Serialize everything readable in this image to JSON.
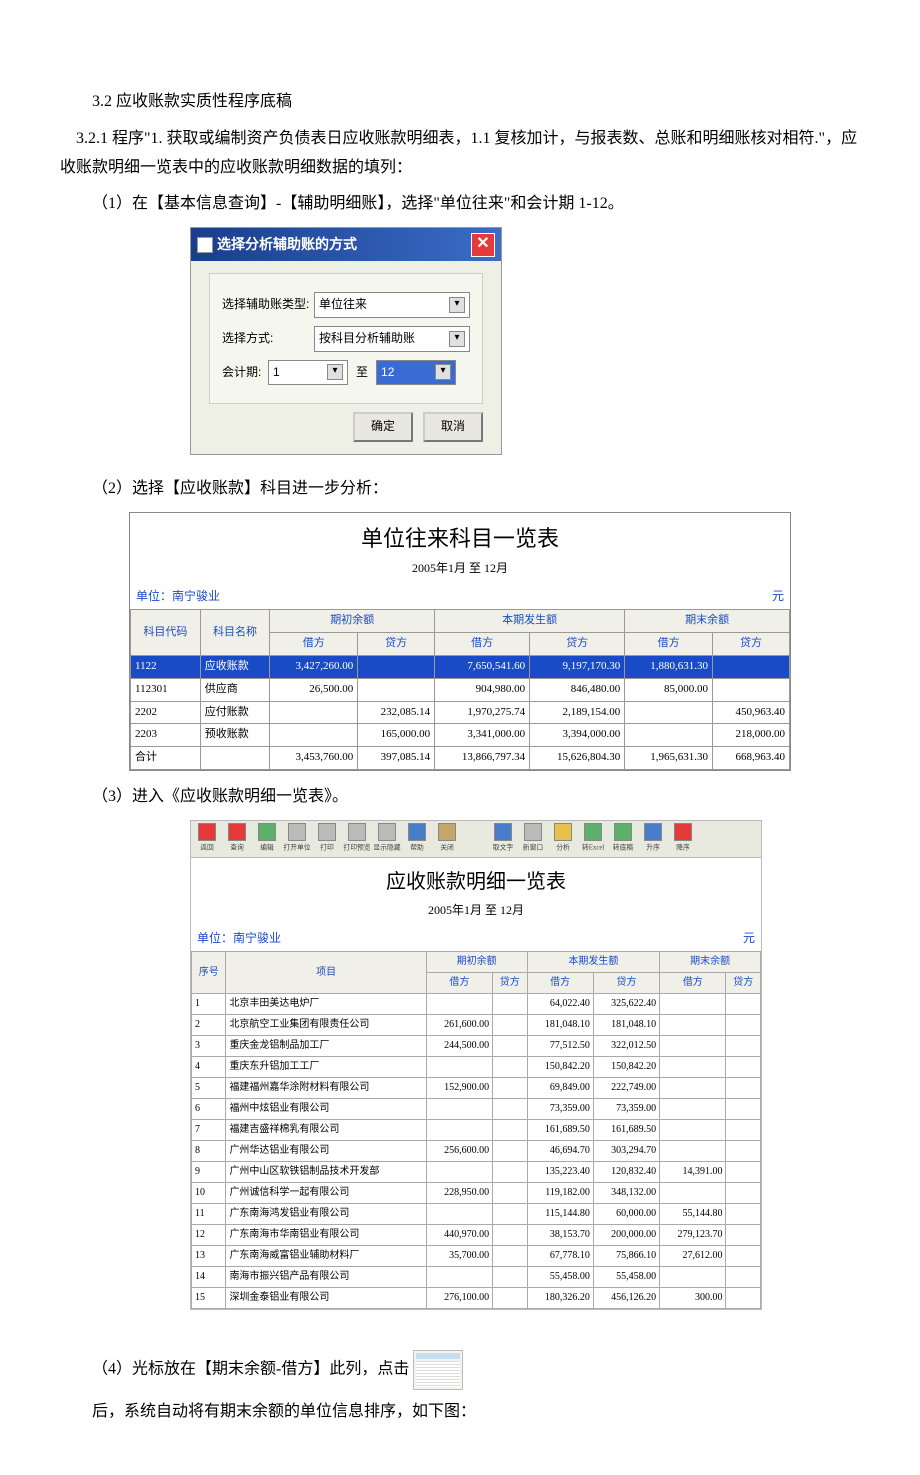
{
  "text": {
    "section_title": "3.2 应收账款实质性程序底稿",
    "p1": "3.2.1 程序\"1. 获取或编制资产负债表日应收账款明细表，1.1 复核加计，与报表数、总账和明细账核对相符.\"，应收账款明细一览表中的应收账款明细数据的填列：",
    "p2": "（1）在【基本信息查询】-【辅助明细账】，选择\"单位往来\"和会计期 1-12。",
    "p3": "（2）选择【应收账款】科目进一步分析：",
    "p4": "（3）进入《应收账款明细一览表》。",
    "p5a": "（4）光标放在【期末余额-借方】此列，点击",
    "p5b": "后，系统自动将有期末余额的单位信息排序，如下图："
  },
  "dialog": {
    "title": "选择分析辅助账的方式",
    "label_type": "选择辅助账类型:",
    "val_type": "单位往来",
    "label_method": "选择方式:",
    "val_method": "按科目分析辅助账",
    "label_period": "会计期:",
    "period_from": "1",
    "period_to": "12",
    "to": "至",
    "ok": "确定",
    "cancel": "取消"
  },
  "table1": {
    "title": "单位往来科目一览表",
    "period": "2005年1月 至 12月",
    "unit_label": "单位：",
    "unit": "南宁骏业",
    "currency": "元",
    "hdr_code": "科目代码",
    "hdr_name": "科目名称",
    "hdr_pb": "期初余额",
    "hdr_cur": "本期发生额",
    "hdr_eb": "期末余额",
    "hdr_debit": "借方",
    "hdr_credit": "贷方",
    "rows": [
      {
        "code": "1122",
        "name": "应收账款",
        "pd": "3,427,260.00",
        "pc": "",
        "cd": "7,650,541.60",
        "cc": "9,197,170.30",
        "ed": "1,880,631.30",
        "ec": "",
        "hl": true
      },
      {
        "code": "112301",
        "name": "供应商",
        "pd": "26,500.00",
        "pc": "",
        "cd": "904,980.00",
        "cc": "846,480.00",
        "ed": "85,000.00",
        "ec": ""
      },
      {
        "code": "2202",
        "name": "应付账款",
        "pd": "",
        "pc": "232,085.14",
        "cd": "1,970,275.74",
        "cc": "2,189,154.00",
        "ed": "",
        "ec": "450,963.40"
      },
      {
        "code": "2203",
        "name": "预收账款",
        "pd": "",
        "pc": "165,000.00",
        "cd": "3,341,000.00",
        "cc": "3,394,000.00",
        "ed": "",
        "ec": "218,000.00"
      },
      {
        "code": "合计",
        "name": "",
        "pd": "3,453,760.00",
        "pc": "397,085.14",
        "cd": "13,866,797.34",
        "cc": "15,626,804.30",
        "ed": "1,965,631.30",
        "ec": "668,963.40"
      }
    ]
  },
  "detail": {
    "title": "应收账款明细一览表",
    "period": "2005年1月 至 12月",
    "unit_label": "单位：",
    "unit": "南宁骏业",
    "currency": "元",
    "hdr_seq": "序号",
    "hdr_item": "项目",
    "hdr_pb": "期初余额",
    "hdr_cur": "本期发生额",
    "hdr_eb": "期末余额",
    "hdr_debit": "借方",
    "hdr_credit": "贷方",
    "toolbar": {
      "t1": "返回",
      "t2": "查询",
      "t3": "编辑",
      "t4": "打开单位",
      "t5": "打印",
      "t6": "打印预览",
      "t7": "显示隐藏",
      "t8": "帮助",
      "t9": "关闭",
      "t10": "取文字",
      "t11": "新窗口",
      "t12": "分析",
      "t13": "转Excel",
      "t14": "转底稿",
      "t15": "升序",
      "t16": "降序"
    },
    "rows": [
      {
        "n": "1",
        "name": "北京丰田美达电炉厂",
        "pd": "",
        "cd": "64,022.40",
        "cc": "325,622.40",
        "ed": "",
        "ec": ""
      },
      {
        "n": "2",
        "name": "北京航空工业集团有限责任公司",
        "pd": "261,600.00",
        "cd": "181,048.10",
        "cc": "181,048.10",
        "ed": "",
        "ec": ""
      },
      {
        "n": "3",
        "name": "重庆金龙铝制品加工厂",
        "pd": "244,500.00",
        "cd": "77,512.50",
        "cc": "322,012.50",
        "ed": "",
        "ec": ""
      },
      {
        "n": "4",
        "name": "重庆东升铝加工工厂",
        "pd": "",
        "cd": "150,842.20",
        "cc": "150,842.20",
        "ed": "",
        "ec": ""
      },
      {
        "n": "5",
        "name": "福建福州嘉华涂附材料有限公司",
        "pd": "152,900.00",
        "cd": "69,849.00",
        "cc": "222,749.00",
        "ed": "",
        "ec": ""
      },
      {
        "n": "6",
        "name": "福州中炫铝业有限公司",
        "pd": "",
        "cd": "73,359.00",
        "cc": "73,359.00",
        "ed": "",
        "ec": ""
      },
      {
        "n": "7",
        "name": "福建吉盛祥棉乳有限公司",
        "pd": "",
        "cd": "161,689.50",
        "cc": "161,689.50",
        "ed": "",
        "ec": ""
      },
      {
        "n": "8",
        "name": "广州华达铝业有限公司",
        "pd": "256,600.00",
        "cd": "46,694.70",
        "cc": "303,294.70",
        "ed": "",
        "ec": ""
      },
      {
        "n": "9",
        "name": "广州中山区软铁铝制品技术开发部",
        "pd": "",
        "cd": "135,223.40",
        "cc": "120,832.40",
        "ed": "14,391.00",
        "ec": ""
      },
      {
        "n": "10",
        "name": "广州诚信科学一起有限公司",
        "pd": "228,950.00",
        "cd": "119,182.00",
        "cc": "348,132.00",
        "ed": "",
        "ec": ""
      },
      {
        "n": "11",
        "name": "广东南海鸿发铝业有限公司",
        "pd": "",
        "cd": "115,144.80",
        "cc": "60,000.00",
        "ed": "55,144.80",
        "ec": ""
      },
      {
        "n": "12",
        "name": "广东南海市华南铝业有限公司",
        "pd": "440,970.00",
        "cd": "38,153.70",
        "cc": "200,000.00",
        "ed": "279,123.70",
        "ec": ""
      },
      {
        "n": "13",
        "name": "广东南海威富铝业辅助材料厂",
        "pd": "35,700.00",
        "cd": "67,778.10",
        "cc": "75,866.10",
        "ed": "27,612.00",
        "ec": ""
      },
      {
        "n": "14",
        "name": "南海市振兴铝产品有限公司",
        "pd": "",
        "cd": "55,458.00",
        "cc": "55,458.00",
        "ed": "",
        "ec": ""
      },
      {
        "n": "15",
        "name": "深圳金泰铝业有限公司",
        "pd": "276,100.00",
        "cd": "180,326.20",
        "cc": "456,126.20",
        "ed": "300.00",
        "ec": ""
      }
    ]
  }
}
